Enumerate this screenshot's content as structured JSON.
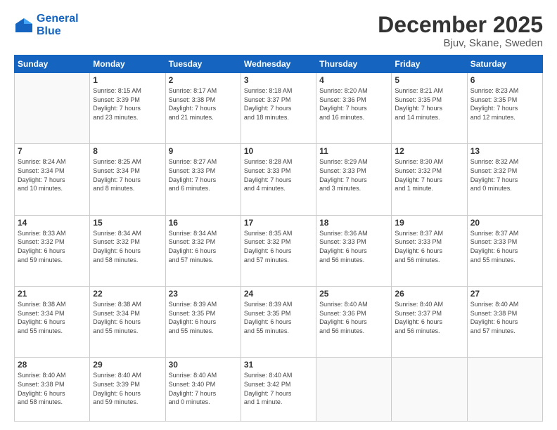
{
  "header": {
    "logo": {
      "line1": "General",
      "line2": "Blue"
    },
    "title": "December 2025",
    "location": "Bjuv, Skane, Sweden"
  },
  "weekdays": [
    "Sunday",
    "Monday",
    "Tuesday",
    "Wednesday",
    "Thursday",
    "Friday",
    "Saturday"
  ],
  "weeks": [
    [
      {
        "day": "",
        "content": ""
      },
      {
        "day": "1",
        "content": "Sunrise: 8:15 AM\nSunset: 3:39 PM\nDaylight: 7 hours\nand 23 minutes."
      },
      {
        "day": "2",
        "content": "Sunrise: 8:17 AM\nSunset: 3:38 PM\nDaylight: 7 hours\nand 21 minutes."
      },
      {
        "day": "3",
        "content": "Sunrise: 8:18 AM\nSunset: 3:37 PM\nDaylight: 7 hours\nand 18 minutes."
      },
      {
        "day": "4",
        "content": "Sunrise: 8:20 AM\nSunset: 3:36 PM\nDaylight: 7 hours\nand 16 minutes."
      },
      {
        "day": "5",
        "content": "Sunrise: 8:21 AM\nSunset: 3:35 PM\nDaylight: 7 hours\nand 14 minutes."
      },
      {
        "day": "6",
        "content": "Sunrise: 8:23 AM\nSunset: 3:35 PM\nDaylight: 7 hours\nand 12 minutes."
      }
    ],
    [
      {
        "day": "7",
        "content": "Sunrise: 8:24 AM\nSunset: 3:34 PM\nDaylight: 7 hours\nand 10 minutes."
      },
      {
        "day": "8",
        "content": "Sunrise: 8:25 AM\nSunset: 3:34 PM\nDaylight: 7 hours\nand 8 minutes."
      },
      {
        "day": "9",
        "content": "Sunrise: 8:27 AM\nSunset: 3:33 PM\nDaylight: 7 hours\nand 6 minutes."
      },
      {
        "day": "10",
        "content": "Sunrise: 8:28 AM\nSunset: 3:33 PM\nDaylight: 7 hours\nand 4 minutes."
      },
      {
        "day": "11",
        "content": "Sunrise: 8:29 AM\nSunset: 3:33 PM\nDaylight: 7 hours\nand 3 minutes."
      },
      {
        "day": "12",
        "content": "Sunrise: 8:30 AM\nSunset: 3:32 PM\nDaylight: 7 hours\nand 1 minute."
      },
      {
        "day": "13",
        "content": "Sunrise: 8:32 AM\nSunset: 3:32 PM\nDaylight: 7 hours\nand 0 minutes."
      }
    ],
    [
      {
        "day": "14",
        "content": "Sunrise: 8:33 AM\nSunset: 3:32 PM\nDaylight: 6 hours\nand 59 minutes."
      },
      {
        "day": "15",
        "content": "Sunrise: 8:34 AM\nSunset: 3:32 PM\nDaylight: 6 hours\nand 58 minutes."
      },
      {
        "day": "16",
        "content": "Sunrise: 8:34 AM\nSunset: 3:32 PM\nDaylight: 6 hours\nand 57 minutes."
      },
      {
        "day": "17",
        "content": "Sunrise: 8:35 AM\nSunset: 3:32 PM\nDaylight: 6 hours\nand 57 minutes."
      },
      {
        "day": "18",
        "content": "Sunrise: 8:36 AM\nSunset: 3:33 PM\nDaylight: 6 hours\nand 56 minutes."
      },
      {
        "day": "19",
        "content": "Sunrise: 8:37 AM\nSunset: 3:33 PM\nDaylight: 6 hours\nand 56 minutes."
      },
      {
        "day": "20",
        "content": "Sunrise: 8:37 AM\nSunset: 3:33 PM\nDaylight: 6 hours\nand 55 minutes."
      }
    ],
    [
      {
        "day": "21",
        "content": "Sunrise: 8:38 AM\nSunset: 3:34 PM\nDaylight: 6 hours\nand 55 minutes."
      },
      {
        "day": "22",
        "content": "Sunrise: 8:38 AM\nSunset: 3:34 PM\nDaylight: 6 hours\nand 55 minutes."
      },
      {
        "day": "23",
        "content": "Sunrise: 8:39 AM\nSunset: 3:35 PM\nDaylight: 6 hours\nand 55 minutes."
      },
      {
        "day": "24",
        "content": "Sunrise: 8:39 AM\nSunset: 3:35 PM\nDaylight: 6 hours\nand 55 minutes."
      },
      {
        "day": "25",
        "content": "Sunrise: 8:40 AM\nSunset: 3:36 PM\nDaylight: 6 hours\nand 56 minutes."
      },
      {
        "day": "26",
        "content": "Sunrise: 8:40 AM\nSunset: 3:37 PM\nDaylight: 6 hours\nand 56 minutes."
      },
      {
        "day": "27",
        "content": "Sunrise: 8:40 AM\nSunset: 3:38 PM\nDaylight: 6 hours\nand 57 minutes."
      }
    ],
    [
      {
        "day": "28",
        "content": "Sunrise: 8:40 AM\nSunset: 3:38 PM\nDaylight: 6 hours\nand 58 minutes."
      },
      {
        "day": "29",
        "content": "Sunrise: 8:40 AM\nSunset: 3:39 PM\nDaylight: 6 hours\nand 59 minutes."
      },
      {
        "day": "30",
        "content": "Sunrise: 8:40 AM\nSunset: 3:40 PM\nDaylight: 7 hours\nand 0 minutes."
      },
      {
        "day": "31",
        "content": "Sunrise: 8:40 AM\nSunset: 3:42 PM\nDaylight: 7 hours\nand 1 minute."
      },
      {
        "day": "",
        "content": ""
      },
      {
        "day": "",
        "content": ""
      },
      {
        "day": "",
        "content": ""
      }
    ]
  ]
}
